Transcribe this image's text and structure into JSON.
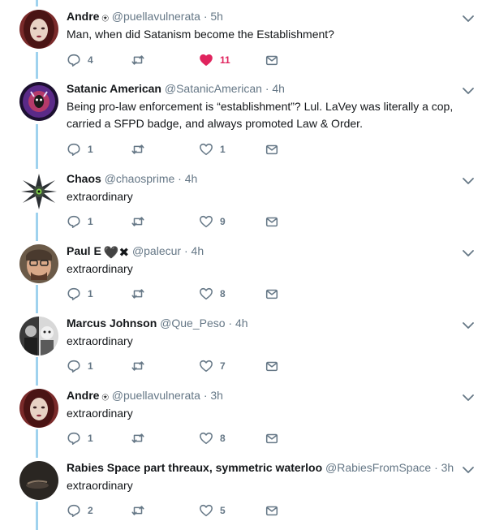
{
  "colors": {
    "text": "#14171a",
    "meta": "#657786",
    "like": "#e0245e",
    "thread_line": "#9fd2ee"
  },
  "tweets": [
    {
      "name": "Andre",
      "name_emoji": "⍟",
      "handle": "@puellavulnerata",
      "dot": "·",
      "time": "5h",
      "text": "Man, when did Satanism become the Establishment?",
      "replies": "4",
      "retweets": "",
      "likes": "11",
      "liked": true
    },
    {
      "name": "Satanic American",
      "handle": "@SatanicAmerican",
      "dot": "·",
      "time": "4h",
      "text": "Being pro-law enforcement is “establishment”? Lul. LaVey was literally a cop, carried a SFPD badge, and always promoted Law & Order.",
      "replies": "1",
      "retweets": "",
      "likes": "1"
    },
    {
      "name": "Chaos",
      "handle": "@chaosprime",
      "dot": "·",
      "time": "4h",
      "text": "extraordinary",
      "replies": "1",
      "retweets": "",
      "likes": "9"
    },
    {
      "name": "Paul E",
      "name_emoji": "🖤✖",
      "handle": "@palecur",
      "dot": "·",
      "time": "4h",
      "text": "extraordinary",
      "replies": "1",
      "retweets": "",
      "likes": "8"
    },
    {
      "name": "Marcus Johnson",
      "handle": "@Que_Peso",
      "dot": "·",
      "time": "4h",
      "text": "extraordinary",
      "replies": "1",
      "retweets": "",
      "likes": "7"
    },
    {
      "name": "Andre",
      "name_emoji": "⍟",
      "handle": "@puellavulnerata",
      "dot": "·",
      "time": "3h",
      "text": "extraordinary",
      "replies": "1",
      "retweets": "",
      "likes": "8"
    },
    {
      "name": "Rabies Space part threaux, symmetric waterloo",
      "handle": "@RabiesFromSpace",
      "dot": "·",
      "time": "3h",
      "text": "extraordinary",
      "replies": "2",
      "retweets": "",
      "likes": "5"
    }
  ]
}
